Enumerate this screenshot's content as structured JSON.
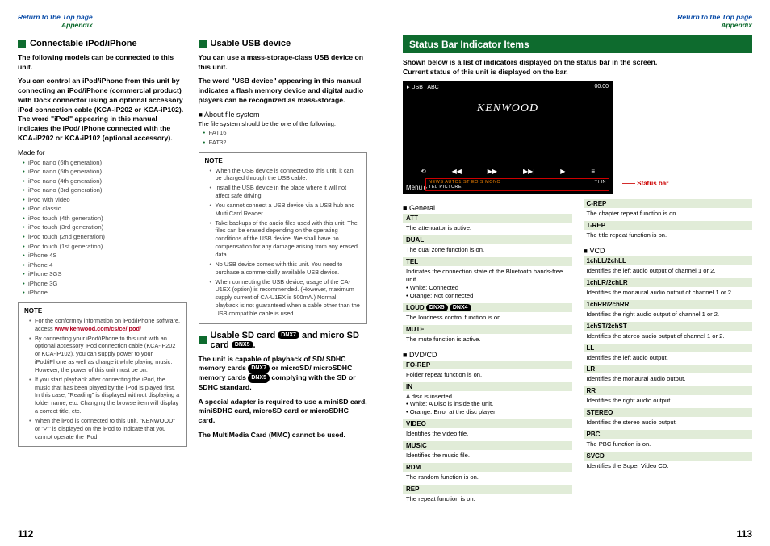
{
  "nav": {
    "return": "Return to the Top page",
    "appendix": "Appendix"
  },
  "left": {
    "col1": {
      "head": "Connectable iPod/iPhone",
      "intro": "The following models can be connected to this unit.",
      "body": "You can control an iPod/iPhone from this unit by connecting an iPod/iPhone (commercial product) with Dock connector using an optional accessory iPod connection cable (KCA-iP202 or KCA-iP102). The word \"iPod\" appearing in this manual indicates the iPod/ iPhone connected with the KCA-iP202 or KCA-iP102 (optional accessory).",
      "madefor": "Made for",
      "models": [
        "iPod nano (6th generation)",
        "iPod nano (5th generation)",
        "iPod nano (4th generation)",
        "iPod nano (3rd generation)",
        "iPod with video",
        "iPod classic",
        "iPod touch (4th generation)",
        "iPod touch (3rd generation)",
        "iPod touch (2nd generation)",
        "iPod touch (1st generation)",
        "iPhone 4S",
        "iPhone 4",
        "iPhone 3GS",
        "iPhone 3G",
        "iPhone"
      ],
      "note_title": "NOTE",
      "notes": [
        "For the conformity information on iPod/iPhone software, access ",
        "By connecting your iPod/iPhone to this unit with an optional accessory iPod connection cable (KCA-iP202 or KCA-iP102), you can supply power to your iPod/iPhone as well as charge it while playing music. However, the power of this unit must be on.",
        "If you start playback after connecting the iPod, the music that has been played by the iPod is played first. In this case, \"Reading\" is displayed without displaying a folder name, etc. Changing the browse item will display a correct title, etc.",
        "When the iPod is connected to this unit, \"KENWOOD\" or \"✓\" is displayed on the iPod to indicate that you cannot operate the iPod."
      ],
      "note_link": "www.kenwood.com/cs/ce/ipod/"
    },
    "col2": {
      "head": "Usable USB device",
      "intro": "You can use a mass-storage-class USB device on this unit.",
      "body": "The word \"USB device\" appearing in this manual indicates a flash memory device and digital audio players can be recognized as mass-storage.",
      "fs_head": "About file system",
      "fs_text": "The file system should be the one of the following.",
      "fs_list": [
        "FAT16",
        "FAT32"
      ],
      "note_title": "NOTE",
      "notes": [
        "When the USB device is connected to this unit, it can be charged through the USB cable.",
        "Install the USB device in the place where it will not affect safe driving.",
        "You cannot connect a USB device via a USB hub and Multi Card Reader.",
        "Take backups of the audio files used with this unit. The files can be erased depending on the operating conditions of the USB device. We shall have no compensation for any damage arising from any erased data.",
        "No USB device comes with this unit. You need to purchase a commercially available USB device.",
        "When connecting the USB device, usage of the CA-U1EX (option) is recommended. (However, maximum supply current of CA-U1EX is 500mA.) Normal playback is not guaranteed when a cable other than the USB compatible cable is used."
      ],
      "sd_head_a": "Usable SD card",
      "sd_head_b": "and micro SD card",
      "sd_badge1": "DNX7",
      "sd_badge2": "DNX5",
      "sd_body1": "The unit is capable of playback of SD/ SDHC memory cards ",
      "sd_body1b": " or microSD/ microSDHC memory cards ",
      "sd_body1c": " complying with the SD or SDHC standard.",
      "sd_body2": "A special adapter is required to use a miniSD card, miniSDHC card, microSD card or microSDHC card.",
      "sd_body3": "The MultiMedia Card (MMC) cannot be used."
    },
    "pagenum": "112"
  },
  "right": {
    "title": "Status Bar Indicator Items",
    "intro1": "Shown below is a list of indicators displayed on the status bar in the screen.",
    "intro2": "Current status of this unit is displayed on the bar.",
    "screen": {
      "usb": "USB",
      "abc": "ABC",
      "time": "00:00",
      "brand": "KENWOOD",
      "ctrl": [
        "⟲",
        "◀◀",
        "▶▶",
        "▶▶|",
        "▶",
        "≡"
      ],
      "menu": "Menu",
      "status_left": "NEWS   AUTO1   ST   EO.S   MONO",
      "status_right": "TI   IN",
      "status_left2": "TEL   PICTURE"
    },
    "status_label": "Status bar",
    "col1": {
      "general": "General",
      "items": [
        {
          "h": "ATT",
          "d": "The attenuator is active."
        },
        {
          "h": "DUAL",
          "d": "The dual zone function is on."
        },
        {
          "h": "TEL",
          "d": "Indicates the connection state of the Bluetooth hands-free unit.\n• White: Connected\n• Orange: Not connected"
        },
        {
          "h": "LOUD",
          "badges": [
            "DNX5",
            "DNX4"
          ],
          "d": "The loudness control function is on."
        },
        {
          "h": "MUTE",
          "d": "The mute function is active."
        }
      ],
      "dvd": "DVD/CD",
      "dvd_items": [
        {
          "h": "FO-REP",
          "d": "Folder repeat function is on."
        },
        {
          "h": "IN",
          "d": "A disc is inserted.\n• White: A Disc is inside the unit.\n• Orange: Error at the disc player"
        },
        {
          "h": "VIDEO",
          "d": "Identifies the video file."
        },
        {
          "h": "MUSIC",
          "d": "Identifies the music file."
        },
        {
          "h": "RDM",
          "d": "The random function is on."
        },
        {
          "h": "REP",
          "d": "The repeat function is on."
        }
      ]
    },
    "col2": {
      "pre": [
        {
          "h": "C-REP",
          "d": "The chapter repeat function is on."
        },
        {
          "h": "T-REP",
          "d": "The title repeat function is on."
        }
      ],
      "vcd": "VCD",
      "vcd_items": [
        {
          "h": "1chLL/2chLL",
          "d": "Identifies the left audio output of channel 1 or 2."
        },
        {
          "h": "1chLR/2chLR",
          "d": "Identifies the monaural audio output of channel 1 or 2."
        },
        {
          "h": "1chRR/2chRR",
          "d": "Identifies the right audio output of channel 1 or 2."
        },
        {
          "h": "1chST/2chST",
          "d": "Identifies the stereo audio output of channel 1 or 2."
        },
        {
          "h": "LL",
          "d": "Identifies the left audio output."
        },
        {
          "h": "LR",
          "d": "Identifies the monaural audio output."
        },
        {
          "h": "RR",
          "d": "Identifies the right audio output."
        },
        {
          "h": "STEREO",
          "d": "Identifies the stereo audio output."
        },
        {
          "h": "PBC",
          "d": "The PBC function is on."
        },
        {
          "h": "SVCD",
          "d": "Identifies the Super Video CD."
        }
      ]
    },
    "pagenum": "113"
  }
}
